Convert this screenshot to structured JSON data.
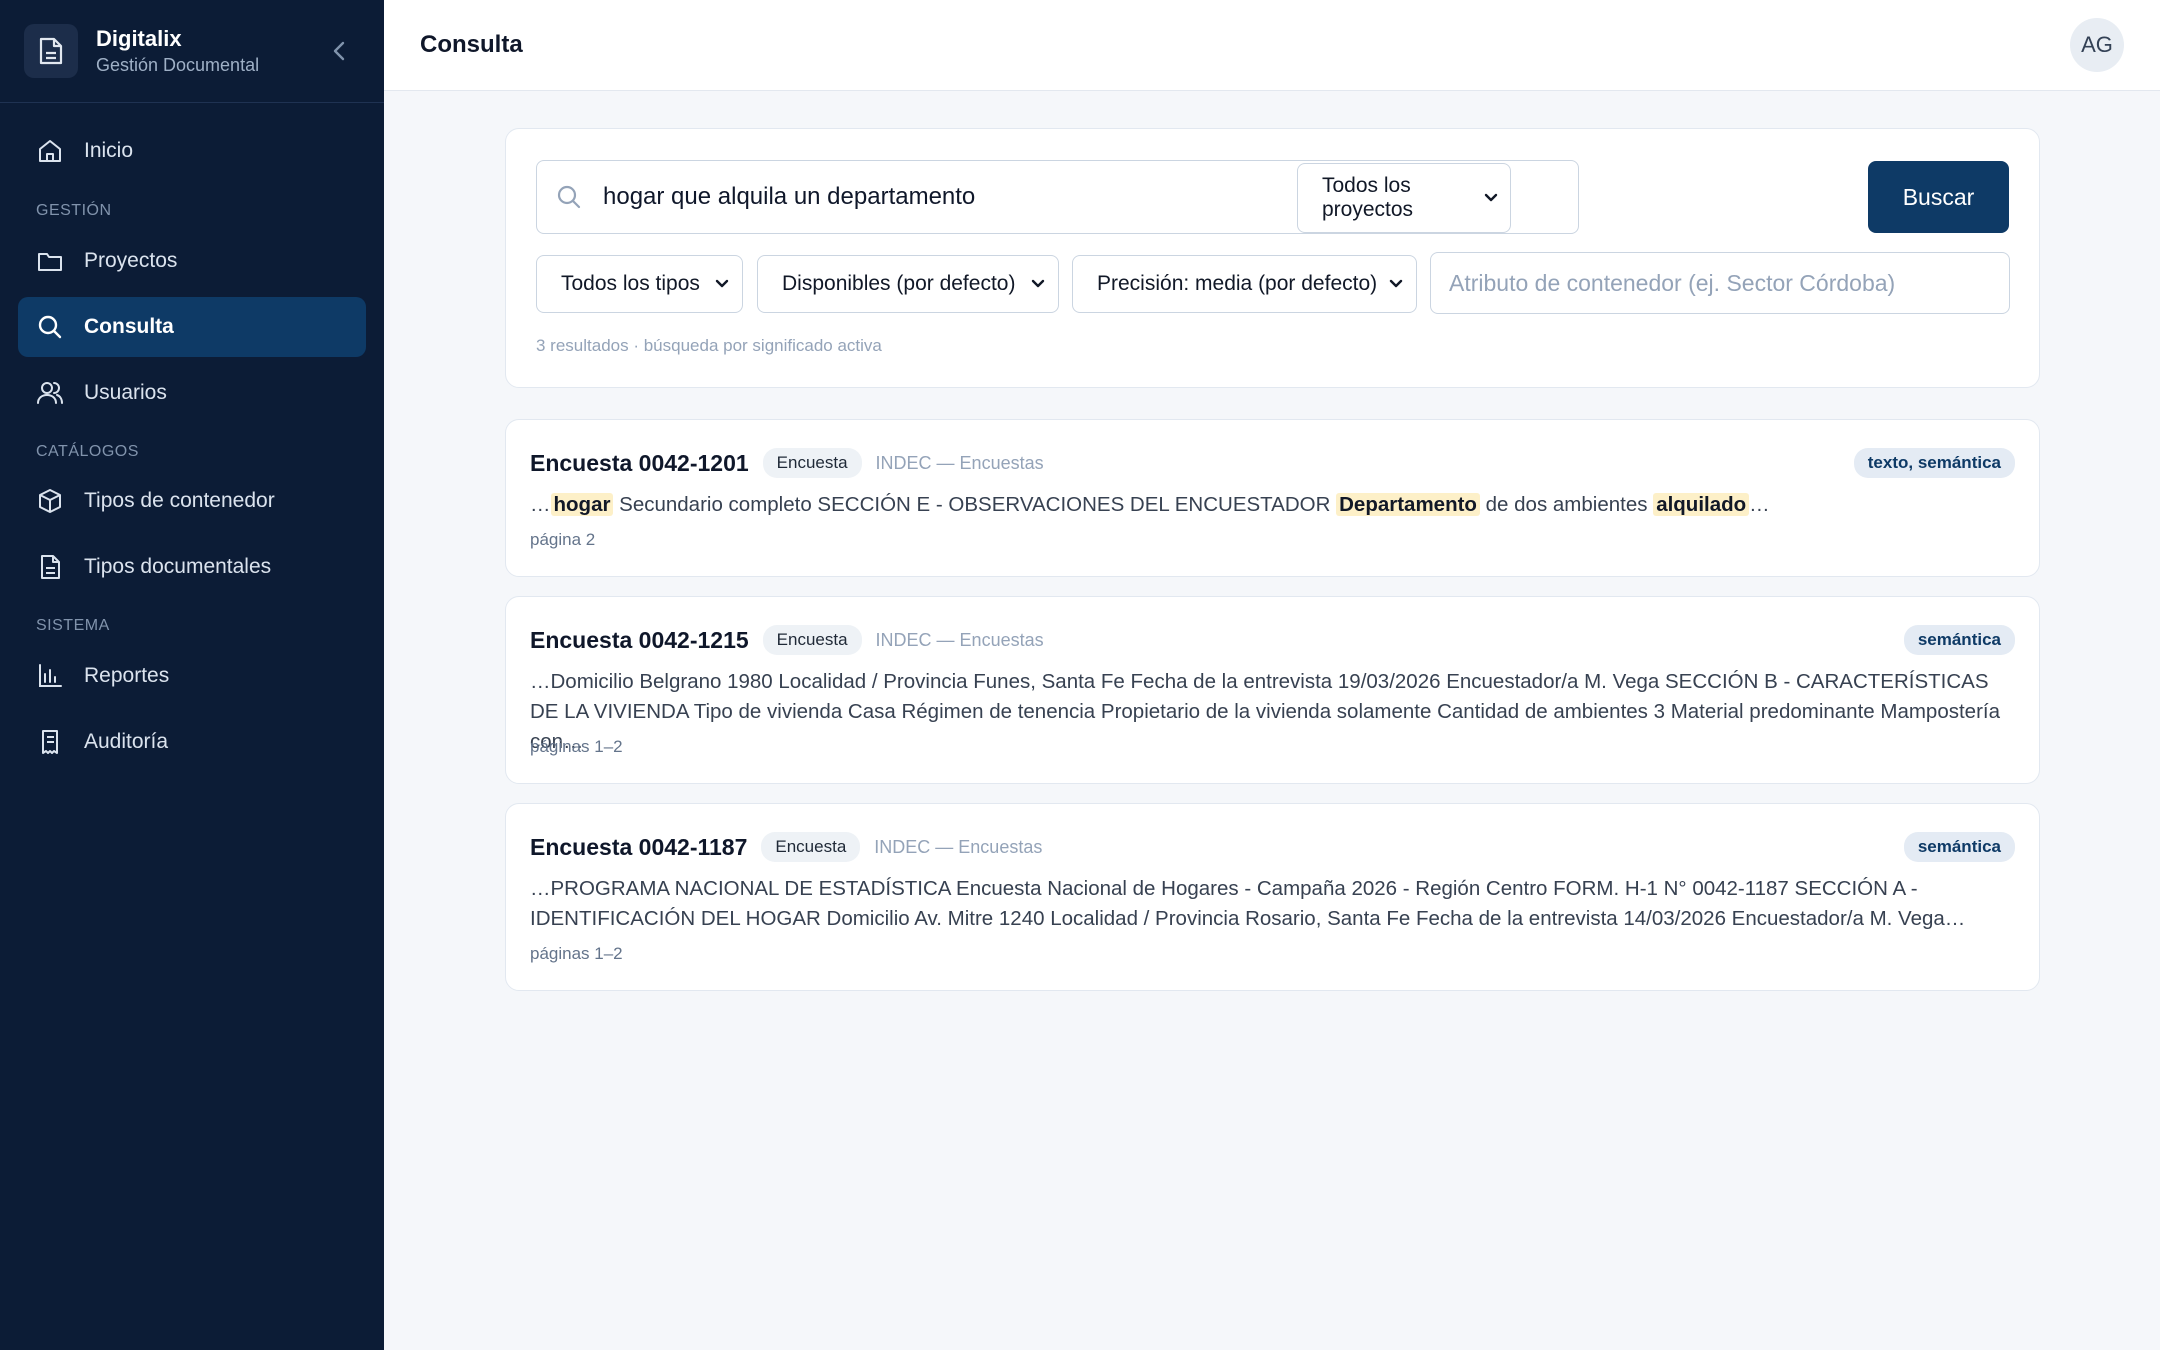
{
  "brand": {
    "name": "Digitalix",
    "subtitle": "Gestión Documental"
  },
  "nav": {
    "home": "Inicio",
    "section_gestion": "GESTIÓN",
    "projects": "Proyectos",
    "search": "Consulta",
    "users": "Usuarios",
    "section_catalogos": "CATÁLOGOS",
    "container_types": "Tipos de contenedor",
    "document_types": "Tipos documentales",
    "section_sistema": "SISTEMA",
    "reports": "Reportes",
    "audit": "Auditoría",
    "active_item": "Consulta"
  },
  "header": {
    "title": "Consulta",
    "avatar_initials": "AG"
  },
  "search": {
    "query": "hogar que alquila un departamento",
    "project_select": "Todos los proyectos",
    "button": "Buscar",
    "type_select": "Todos los tipos",
    "availability_select": "Disponibles (por defecto)",
    "precision_select": "Precisión: media (por defecto)",
    "attribute_placeholder": "Atributo de contenedor (ej. Sector Córdoba)",
    "status": "3 resultados · búsqueda por significado activa"
  },
  "results": [
    {
      "title": "Encuesta 0042-1201",
      "type": "Encuesta",
      "source": "INDEC — Encuestas",
      "match": "texto, semántica",
      "snippet_parts": {
        "p0": "…",
        "h1": "hogar",
        "p1": " Secundario completo SECCIÓN E - OBSERVACIONES DEL ENCUESTADOR ",
        "h2": "Departamento",
        "p2": " de dos ambientes ",
        "h3": "alquilado",
        "p3": "…"
      },
      "pages": "página 2"
    },
    {
      "title": "Encuesta 0042-1215",
      "type": "Encuesta",
      "source": "INDEC — Encuestas",
      "match": "semántica",
      "snippet": "…Domicilio Belgrano 1980 Localidad / Provincia Funes, Santa Fe Fecha de la entrevista 19/03/2026 Encuestador/a M. Vega SECCIÓN B - CARACTERÍSTICAS DE LA VIVIENDA Tipo de vivienda Casa Régimen de tenencia Propietario de la vivienda solamente Cantidad de ambientes 3 Material predominante Mampostería con…",
      "pages": "páginas 1–2"
    },
    {
      "title": "Encuesta 0042-1187",
      "type": "Encuesta",
      "source": "INDEC — Encuestas",
      "match": "semántica",
      "snippet": "…PROGRAMA NACIONAL DE ESTADÍSTICA Encuesta Nacional de Hogares - Campaña 2026 - Región Centro FORM. H-1 N° 0042-1187 SECCIÓN A - IDENTIFICACIÓN DEL HOGAR Domicilio Av. Mitre 1240 Localidad / Provincia Rosario, Santa Fe Fecha de la entrevista 14/03/2026 Encuestador/a M. Vega…",
      "pages": "páginas 1–2"
    }
  ],
  "colors": {
    "sidebar_bg": "#0c1c36",
    "accent": "#0e3a66",
    "highlight": "#fdf0c8"
  },
  "icons": {
    "brand": "document-icon",
    "collapse": "chevron-left-icon",
    "home": "home-icon",
    "projects": "folder-icon",
    "search": "search-icon",
    "users": "users-icon",
    "container_types": "box-icon",
    "document_types": "document-icon",
    "reports": "bar-chart-icon",
    "audit": "receipt-icon"
  }
}
